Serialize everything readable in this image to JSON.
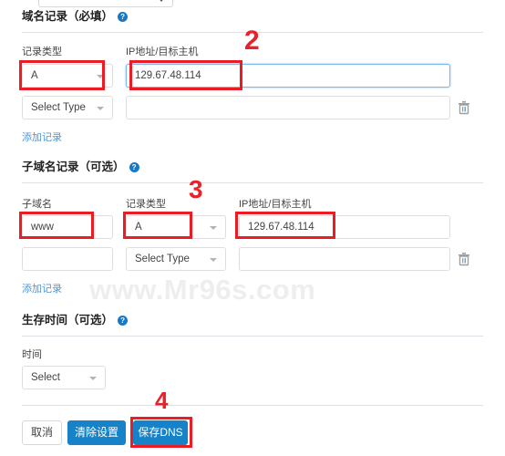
{
  "watermark": "www.Mr96s.com",
  "icons": {
    "help": "?",
    "trash": "trash-icon",
    "chevron_down": "chevron-down-icon"
  },
  "colors": {
    "accent_blue": "#1682c8",
    "link_blue": "#4c96d7",
    "annotation_red": "#ec1c24",
    "focus_border": "#7cb8ec",
    "watermark_gray": "#eeeeee"
  },
  "domain_section": {
    "title": "域名记录",
    "requirement": "（必填）",
    "labels": {
      "record_type": "记录类型",
      "ip_host": "IP地址/目标主机"
    },
    "rows": [
      {
        "record_type_value": "A",
        "ip_value": "129.67.48.114",
        "ip_placeholder": "",
        "ip_focused": true,
        "has_delete": false
      },
      {
        "record_type_value": "Select Type",
        "ip_value": "",
        "ip_placeholder": "",
        "ip_focused": false,
        "has_delete": true
      }
    ],
    "add_record_link": "添加记录"
  },
  "subdomain_section": {
    "title": "子域名记录",
    "requirement": "（可选）",
    "labels": {
      "subdomain": "子域名",
      "record_type": "记录类型",
      "ip_host": "IP地址/目标主机"
    },
    "rows": [
      {
        "subdomain_value": "www",
        "record_type_value": "A",
        "ip_value": "129.67.48.114",
        "has_delete": false
      },
      {
        "subdomain_value": "",
        "record_type_value": "Select Type",
        "ip_value": "",
        "has_delete": true
      }
    ],
    "add_record_link": "添加记录"
  },
  "ttl_section": {
    "title": "生存时间",
    "requirement": "（可选）",
    "labels": {
      "time": "时间"
    },
    "select_value": "Select"
  },
  "footer": {
    "cancel_label": "取消",
    "clear_label": "清除设置",
    "save_label": "保存DNS"
  },
  "annotations": {
    "step2": "2",
    "step3": "3",
    "step4": "4"
  }
}
